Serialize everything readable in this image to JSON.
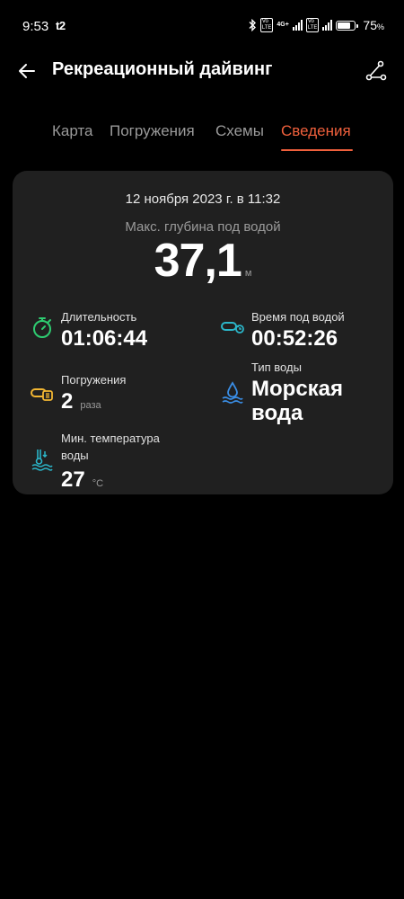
{
  "status": {
    "time": "9:53",
    "carrier": "t2",
    "battery": "75",
    "battery_suffix": "%"
  },
  "header": {
    "title": "Рекреационный дайвинг"
  },
  "tabs": [
    {
      "label": "Карта",
      "active": false
    },
    {
      "label": "Погружения",
      "active": false
    },
    {
      "label": "Схемы",
      "active": false
    },
    {
      "label": "Сведения",
      "active": true
    }
  ],
  "summary": {
    "date": "12 ноября 2023 г. в 11:32",
    "max_depth_label": "Макс. глубина под водой",
    "max_depth_value": "37,1",
    "max_depth_unit": "м"
  },
  "metrics": {
    "duration": {
      "label": "Длительность",
      "value": "01:06:44"
    },
    "underwater_time": {
      "label": "Время под водой",
      "value": "00:52:26"
    },
    "dives": {
      "label": "Погружения",
      "value": "2",
      "unit": "раза"
    },
    "water_type": {
      "label": "Тип воды",
      "value_line1": "Морская",
      "value_line2": "вода"
    },
    "min_temp": {
      "label_line1": "Мин. температура",
      "label_line2": "воды",
      "value": "27",
      "unit": "°C"
    }
  },
  "colors": {
    "accent": "#f0603c",
    "duration_icon": "#2ecc71",
    "underwater_icon": "#2bb5c8",
    "dives_icon": "#f2b632",
    "water_type_icon": "#3a8ee6",
    "temp_icon": "#2bb5c8"
  },
  "icons": {
    "back": "arrow-left-icon",
    "route": "route-icon",
    "duration": "stopwatch-icon",
    "underwater_time": "scuba-tank-icon",
    "dives": "dive-count-icon",
    "water_type": "water-drop-icon",
    "min_temp": "water-thermometer-icon"
  }
}
